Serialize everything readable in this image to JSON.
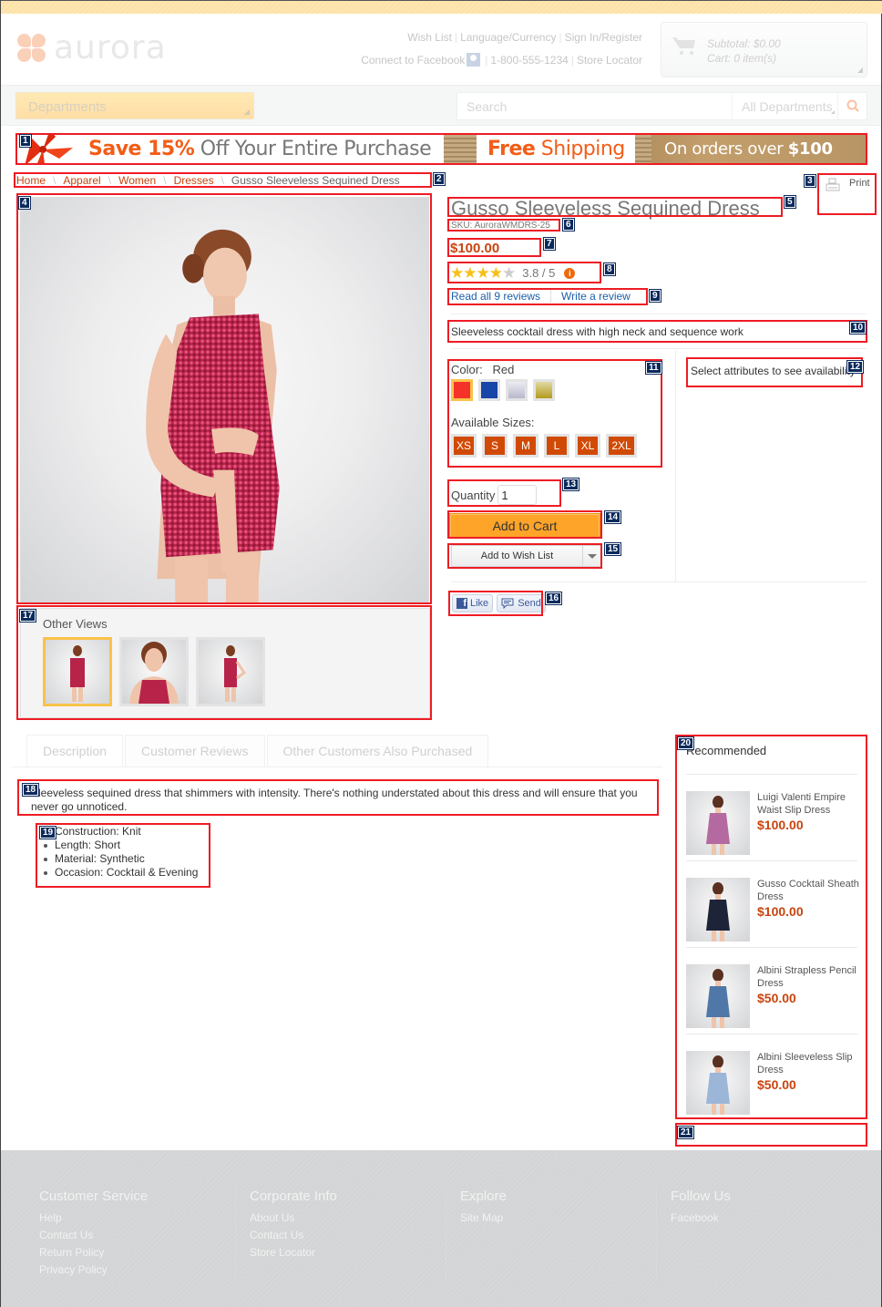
{
  "header": {
    "logo_text": "aurora",
    "links_row1": [
      "Wish List",
      "Language/Currency",
      "Sign In/Register"
    ],
    "links_row2": {
      "facebook": "Connect to Facebook",
      "phone": "1-800-555-1234",
      "store_locator": "Store Locator"
    },
    "cart": {
      "subtotal": "Subtotal: $0.00",
      "items": "Cart: 0 item(s)"
    }
  },
  "nav": {
    "departments_label": "Departments",
    "search_placeholder": "Search",
    "search_scope": "All Departments"
  },
  "banner": {
    "save_highlight": "Save 15%",
    "save_rest": " Off Your Entire Purchase",
    "free_bold": "Free",
    "free_rest": " Shipping",
    "orders_text": "On orders over ",
    "orders_amount": "$100"
  },
  "breadcrumb": {
    "items": [
      "Home",
      "Apparel",
      "Women",
      "Dresses"
    ],
    "current": "Gusso Sleeveless Sequined Dress"
  },
  "print_label": "Print",
  "product": {
    "title": "Gusso Sleeveless Sequined Dress",
    "sku": "SKU: AuroraWMDRS-25",
    "price": "$100.00",
    "rating_value": 3.8,
    "rating_max": 5,
    "rating_text": "3.8 / 5",
    "read_reviews": "Read all 9 reviews",
    "write_review": "Write a review",
    "short_description": "Sleeveless cocktail dress with high neck and sequence work",
    "color_label": "Color:",
    "color_selected": "Red",
    "colors": [
      {
        "name": "Red",
        "hex": "#f5322a",
        "selected": true
      },
      {
        "name": "Blue",
        "hex": "#1745a8",
        "selected": false
      },
      {
        "name": "Silver",
        "hex": "#c9c9d8",
        "selected": false
      },
      {
        "name": "Gold",
        "hex": "#bba631",
        "selected": false
      }
    ],
    "sizes_label": "Available Sizes:",
    "sizes": [
      "XS",
      "S",
      "M",
      "L",
      "XL",
      "2XL"
    ],
    "availability": "Select attributes to see availability",
    "quantity_label": "Quantity",
    "quantity_value": "1",
    "add_to_cart": "Add to Cart",
    "add_to_wishlist": "Add to Wish List",
    "like_label": "Like",
    "send_label": "Send"
  },
  "other_views": {
    "title": "Other Views",
    "count": 3,
    "selected_index": 0
  },
  "tabs": [
    "Description",
    "Customer Reviews",
    "Other Customers Also Purchased"
  ],
  "description": {
    "text": "Sleeveless sequined dress that shimmers with intensity. There's nothing understated about this dress and will ensure that you never go unnoticed.",
    "attributes": [
      "Construction: Knit",
      "Length: Short",
      "Material: Synthetic",
      "Occasion: Cocktail & Evening"
    ]
  },
  "recommended": {
    "title": "Recommended",
    "items": [
      {
        "name": "Luigi Valenti Empire Waist Slip Dress",
        "price": "$100.00",
        "dress_color": "#b46aa0"
      },
      {
        "name": "Gusso Cocktail Sheath Dress",
        "price": "$100.00",
        "dress_color": "#1e2438"
      },
      {
        "name": "Albini Strapless Pencil Dress",
        "price": "$50.00",
        "dress_color": "#4f78a8"
      },
      {
        "name": "Albini Sleeveless Slip Dress",
        "price": "$50.00",
        "dress_color": "#9cb6d8"
      }
    ]
  },
  "footer": {
    "columns": [
      {
        "title": "Customer Service",
        "links": [
          "Help",
          "Contact Us",
          "Return Policy",
          "Privacy Policy"
        ]
      },
      {
        "title": "Corporate Info",
        "links": [
          "About Us",
          "Contact Us",
          "Store Locator"
        ]
      },
      {
        "title": "Explore",
        "links": [
          "Site Map"
        ]
      },
      {
        "title": "Follow Us",
        "links": [
          "Facebook"
        ]
      }
    ]
  },
  "annotations": [
    "1",
    "2",
    "3",
    "4",
    "5",
    "6",
    "7",
    "8",
    "9",
    "10",
    "11",
    "12",
    "13",
    "14",
    "15",
    "16",
    "17",
    "18",
    "19",
    "20",
    "21"
  ],
  "colors": {
    "accent": "#c8440e",
    "link": "#1b5fa8",
    "cta": "#fda429",
    "annotation": "#ee1c24"
  }
}
